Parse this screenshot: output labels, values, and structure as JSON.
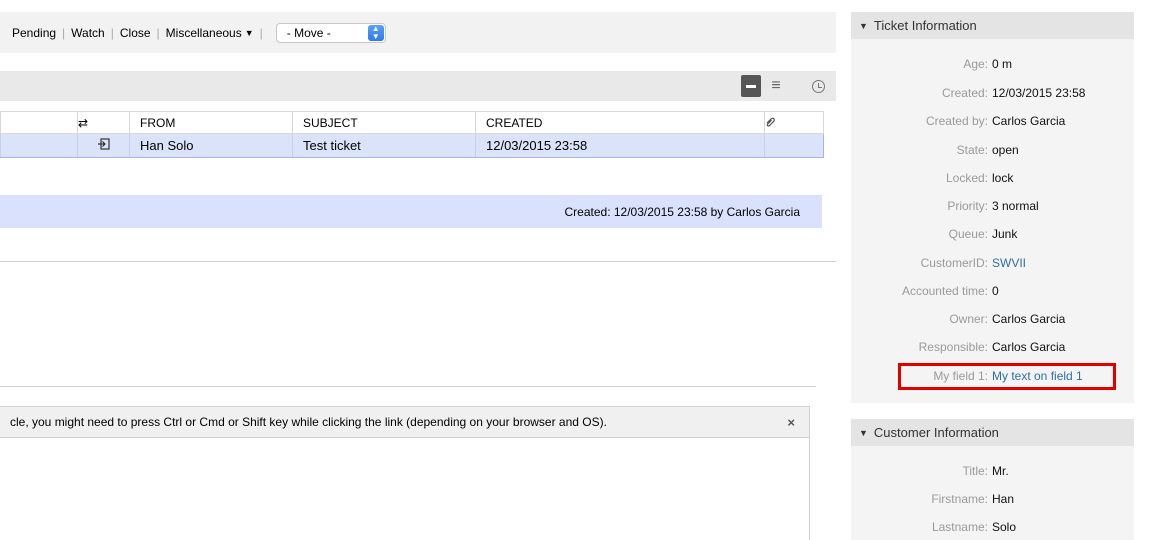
{
  "toolbar": {
    "actions": [
      "Pending",
      "Watch",
      "Close",
      "Miscellaneous"
    ],
    "move_select_value": "- Move -"
  },
  "articles_table": {
    "headers": [
      "",
      "⇄",
      "FROM",
      "SUBJECT",
      "CREATED",
      ""
    ],
    "rows": [
      {
        "type_icon": "⮌",
        "from": "Han Solo",
        "subject": "Test ticket",
        "created": "12/03/2015 23:58"
      }
    ]
  },
  "article_header": {
    "created_text": "Created: 12/03/2015 23:58 by Carlos Garcia"
  },
  "notice": {
    "text": "cle, you might need to press Ctrl or Cmd or Shift key while clicking the link (depending on your browser and OS).",
    "close": "×"
  },
  "ticket_info": {
    "title": "Ticket Information",
    "fields": [
      {
        "label": "Age:",
        "value": "0 m"
      },
      {
        "label": "Created:",
        "value": "12/03/2015 23:58"
      },
      {
        "label": "Created by:",
        "value": "Carlos Garcia"
      },
      {
        "label": "State:",
        "value": "open"
      },
      {
        "label": "Locked:",
        "value": "lock"
      },
      {
        "label": "Priority:",
        "value": "3 normal"
      },
      {
        "label": "Queue:",
        "value": "Junk"
      },
      {
        "label": "CustomerID:",
        "value": "SWVII"
      },
      {
        "label": "Accounted time:",
        "value": "0"
      },
      {
        "label": "Owner:",
        "value": "Carlos Garcia"
      },
      {
        "label": "Responsible:",
        "value": "Carlos Garcia"
      },
      {
        "label": "My field 1:",
        "value": "My text on field 1"
      }
    ]
  },
  "customer_info": {
    "title": "Customer Information",
    "fields": [
      {
        "label": "Title:",
        "value": "Mr."
      },
      {
        "label": "Firstname:",
        "value": "Han"
      },
      {
        "label": "Lastname:",
        "value": "Solo"
      }
    ]
  },
  "colors": {
    "selected_row": "#dbe3fb",
    "link": "#2f6ea6",
    "highlight_border": "#e00000"
  }
}
